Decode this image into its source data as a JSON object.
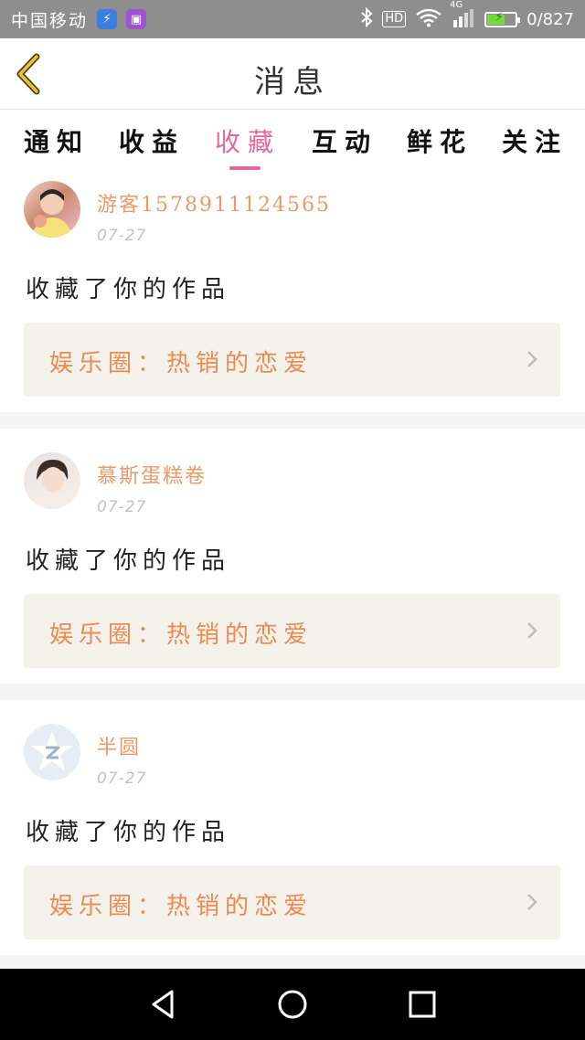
{
  "status_bar": {
    "carrier": "中国移动",
    "hd": "HD",
    "network": "4G",
    "speed": "0/827",
    "icons": [
      "app-icon-blue",
      "app-icon-purple",
      "bluetooth-icon",
      "wifi-icon",
      "signal-icon",
      "battery-icon"
    ]
  },
  "header": {
    "title": "消息",
    "back_icon": "chevron-left-icon"
  },
  "tabs": [
    {
      "label": "通知",
      "active": false
    },
    {
      "label": "收益",
      "active": false
    },
    {
      "label": "收藏",
      "active": true
    },
    {
      "label": "互动",
      "active": false
    },
    {
      "label": "鲜花",
      "active": false
    },
    {
      "label": "关注",
      "active": false
    }
  ],
  "messages": [
    {
      "user": "游客1578911124565",
      "date": "07-27",
      "action": "收藏了你的作品",
      "work": "娱乐圈：热销的恋爱",
      "avatar": "avatar-photo"
    },
    {
      "user": "慕斯蛋糕卷",
      "date": "07-27",
      "action": "收藏了你的作品",
      "work": "娱乐圈：热销的恋爱",
      "avatar": "avatar-photo"
    },
    {
      "user": "半圆",
      "date": "07-27",
      "action": "收藏了你的作品",
      "work": "娱乐圈：热销的恋爱",
      "avatar": "default-avatar-icon"
    }
  ],
  "colors": {
    "accent": "#e8679a",
    "username": "#e99a6a",
    "work_text": "#ed8a52",
    "work_bg": "#f4f2eb",
    "date": "#c2c2c2"
  },
  "nav_bar": {
    "icons": [
      "back-triangle-icon",
      "home-circle-icon",
      "recents-square-icon"
    ]
  }
}
